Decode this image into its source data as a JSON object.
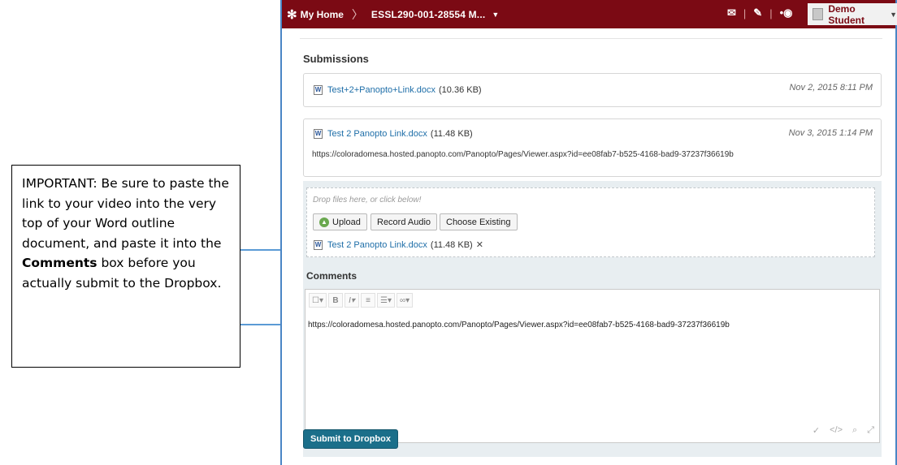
{
  "callout": {
    "text_part1": "IMPORTANT:  Be sure to paste the link to your video into the very top of your Word outline document, and paste it into the ",
    "bold": "Comments",
    "text_part2": " box before you actually submit to the Dropbox."
  },
  "navbar": {
    "home_label": "My Home",
    "course_label": "ESSL290-001-28554 M...",
    "user_name": "Demo Student"
  },
  "submissions": {
    "heading": "Submissions",
    "items": [
      {
        "file_name": "Test+2+Panopto+Link.docx",
        "size": "(10.36 KB)",
        "date": "Nov 2, 2015 8:11 PM",
        "comment": ""
      },
      {
        "file_name": "Test 2 Panopto Link.docx",
        "size": "(11.48 KB)",
        "date": "Nov 3, 2015 1:14 PM",
        "comment": "https://coloradomesa.hosted.panopto.com/Panopto/Pages/Viewer.aspx?id=ee08fab7-b525-4168-bad9-37237f36619b"
      }
    ]
  },
  "dropzone": {
    "hint": "Drop files here, or click below!",
    "upload_label": "Upload",
    "record_label": "Record Audio",
    "choose_label": "Choose Existing",
    "attached_file": "Test 2 Panopto Link.docx",
    "attached_size": "(11.48 KB)"
  },
  "comments": {
    "label": "Comments",
    "text": "https://coloradomesa.hosted.panopto.com/Panopto/Pages/Viewer.aspx?id=ee08fab7-b525-4168-bad9-37237f36619b"
  },
  "submit_label": "Submit to Dropbox",
  "colors": {
    "navbar": "#7b0a14",
    "link": "#1e6ea8",
    "submit": "#1b6f8a",
    "arrow": "#5b9bd5"
  }
}
